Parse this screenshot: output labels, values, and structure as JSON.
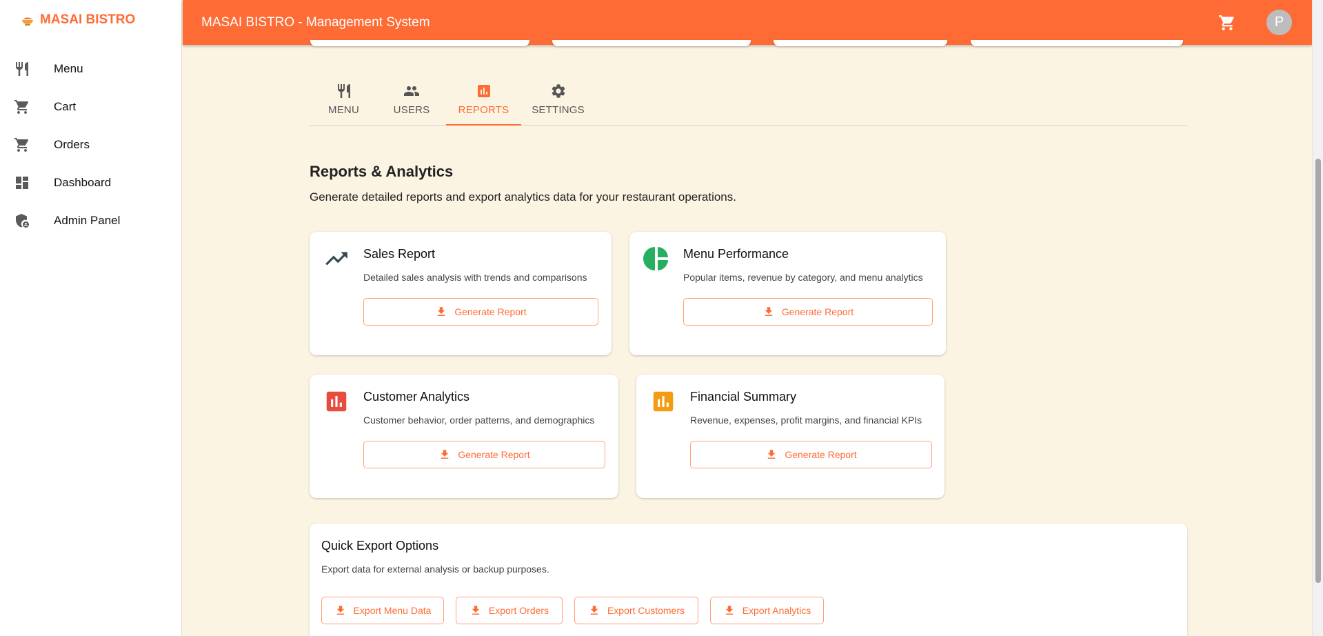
{
  "brand": {
    "name": "MASAI BISTRO",
    "icon": "bowl-icon",
    "color": "#ff6b35"
  },
  "sidebar": {
    "items": [
      {
        "label": "Menu",
        "icon": "restaurant-icon"
      },
      {
        "label": "Cart",
        "icon": "cart-icon"
      },
      {
        "label": "Orders",
        "icon": "cart-icon"
      },
      {
        "label": "Dashboard",
        "icon": "dashboard-icon"
      },
      {
        "label": "Admin Panel",
        "icon": "admin-shield-icon"
      }
    ]
  },
  "header": {
    "title": "MASAI BISTRO - Management System",
    "cart_icon": "cart-icon",
    "avatar_initial": "P",
    "background": "#ff6b35"
  },
  "tabs": [
    {
      "label": "MENU",
      "icon": "restaurant-icon",
      "active": false
    },
    {
      "label": "USERS",
      "icon": "people-icon",
      "active": false
    },
    {
      "label": "REPORTS",
      "icon": "bar-chart-icon",
      "active": true
    },
    {
      "label": "SETTINGS",
      "icon": "gear-icon",
      "active": false
    }
  ],
  "reports": {
    "title": "Reports & Analytics",
    "description": "Generate detailed reports and export analytics data for your restaurant operations.",
    "cards": [
      {
        "title": "Sales Report",
        "description": "Detailed sales analysis with trends and comparisons",
        "button": "Generate Report",
        "icon": "trending-up-icon",
        "icon_color": "#37474f"
      },
      {
        "title": "Menu Performance",
        "description": "Popular items, revenue by category, and menu analytics",
        "button": "Generate Report",
        "icon": "pie-chart-icon",
        "icon_color": "#27ae60"
      },
      {
        "title": "Customer Analytics",
        "description": "Customer behavior, order patterns, and demographics",
        "button": "Generate Report",
        "icon": "bar-chart-icon",
        "icon_color": "#e74c3c"
      },
      {
        "title": "Financial Summary",
        "description": "Revenue, expenses, profit margins, and financial KPIs",
        "button": "Generate Report",
        "icon": "bar-chart-icon",
        "icon_color": "#f39c12"
      }
    ]
  },
  "quick_export": {
    "title": "Quick Export Options",
    "description": "Export data for external analysis or backup purposes.",
    "buttons": [
      {
        "label": "Export Menu Data"
      },
      {
        "label": "Export Orders"
      },
      {
        "label": "Export Customers"
      },
      {
        "label": "Export Analytics"
      }
    ]
  },
  "colors": {
    "accent": "#ff6b35",
    "background": "#fcf4e3"
  }
}
